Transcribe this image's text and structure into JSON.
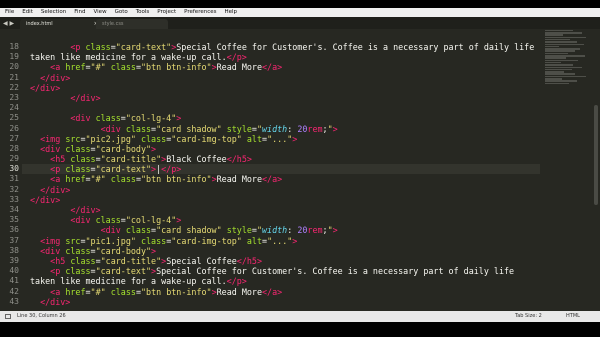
{
  "menu": [
    "File",
    "Edit",
    "Selection",
    "Find",
    "View",
    "Goto",
    "Tools",
    "Project",
    "Preferences",
    "Help"
  ],
  "tabs": {
    "nav": "◀ ▶",
    "active": "index.html",
    "active_close": "×",
    "inactive": "style.css"
  },
  "line_numbers": [
    "18",
    "19",
    "20",
    "21",
    "22",
    "23",
    "24",
    "25",
    "26",
    "27",
    "28",
    "29",
    "30",
    "31",
    "32",
    "33",
    "34",
    "35",
    "36",
    "37",
    "38",
    "39",
    "40",
    "41",
    "42",
    "43"
  ],
  "current_line_index": 12,
  "status": {
    "position": "Line 30, Column 26",
    "tab_size": "Tab Size: 2",
    "syntax": "HTML"
  }
}
